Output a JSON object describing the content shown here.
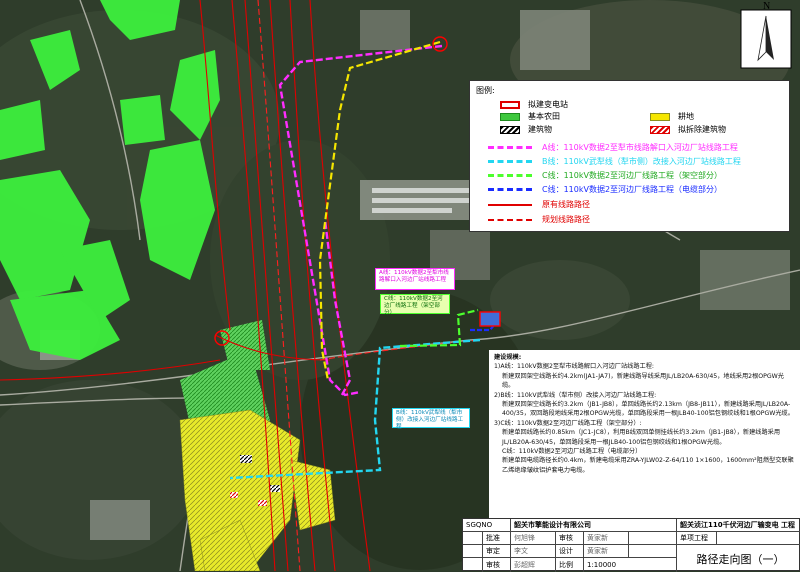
{
  "legend": {
    "title": "图例:",
    "items": [
      {
        "label": "拟建变电站",
        "color": "#e00000"
      },
      {
        "label": "基本农田",
        "color": "#3dc83d"
      },
      {
        "label": "耕地",
        "color": "#f5e600"
      },
      {
        "label": "建筑物",
        "color": "#000000"
      },
      {
        "label": "拟拆除建筑物",
        "color": "#e00000"
      }
    ],
    "lines": [
      {
        "label": "A线：110kV数据2至犁市线路解口入河边厂站线路工程",
        "color": "#ff2dff"
      },
      {
        "label": "B线：110kV武犁线（犁市侧）改接入河边厂站线路工程",
        "color": "#23d6f0"
      },
      {
        "label": "C线：110kV数据2至河边厂线路工程（架空部分）",
        "color": "#4cff2d"
      },
      {
        "label": "C线：110kV数据2至河边厂线路工程（电缆部分）",
        "color": "#1a2cff"
      },
      {
        "label": "原有线路路径",
        "color": "#e00000"
      },
      {
        "label": "规划线路路径",
        "color": "#e00000"
      }
    ]
  },
  "compass": {
    "north": "N"
  },
  "callouts": {
    "a": "A线：110kV数据2至犁市线路解口入河边厂站线路工程",
    "c": "C线：110kV数据2至河边厂线路工程（架空部分）",
    "b": "B线：110kV武犁线（犁市侧）改接入河边厂站线路工程"
  },
  "notes": {
    "heading": "建设规模:",
    "lines": [
      "1)A线：110kV数据2至犁市线路解口入河边厂站线路工程:",
      "新建双回架空线路长约4.2km(JA1-JA7)，新建线路导线采用JL/LB20A-630/45，地线采用2根OPGW光缆。",
      "2)B线：110kV武犁线（犁市侧）改接入河边厂站线路工程:",
      "新建双回架空线路长约3.2km（JB1-JB8），单回线路长约2.13km（JB8-JB11），新建线路采用JL/LB20A-400/35，双回路段地线采用2根OPGW光缆，单回路段采用一根JLB40-100铝包钢绞线和1根OPGW光缆。",
      "3)C线：110kV数据2至河边厂线路工程（架空部分）:",
      "新建单回线路长约0.85km（JC1-JC8），利用B线双回单侧挂线长约3.2km（JB1-JB8），新建线路采用JL/LB20A-630/45，单回路段采用一根JLB40-100铝包钢绞线和1根OPGW光缆。",
      "C线：110kV数据2至河边厂线路工程（电缆部分）",
      "新建单回电缆路径长约0.4km，新建电缆采用ZRA-YJLW02-Z-64/110 1×1600，1600mm²阻燃型交联聚乙烯绝缘皱纹铝护套电力电缆。"
    ]
  },
  "title_block": {
    "code": "SGQNO",
    "company": "韶关市擎能设计有限公司",
    "project": "韶关浈江110千伏河边厂输变电 工程",
    "r1": [
      "批准",
      "何旭锋",
      "审核",
      "黄家新",
      "单项工程",
      ""
    ],
    "r2": [
      "审定",
      "李文",
      "设计",
      "黄家新"
    ],
    "r3": [
      "审核",
      "彭超辉",
      "比例",
      "1:10000"
    ],
    "drawing_title": "路径走向图（一）"
  }
}
